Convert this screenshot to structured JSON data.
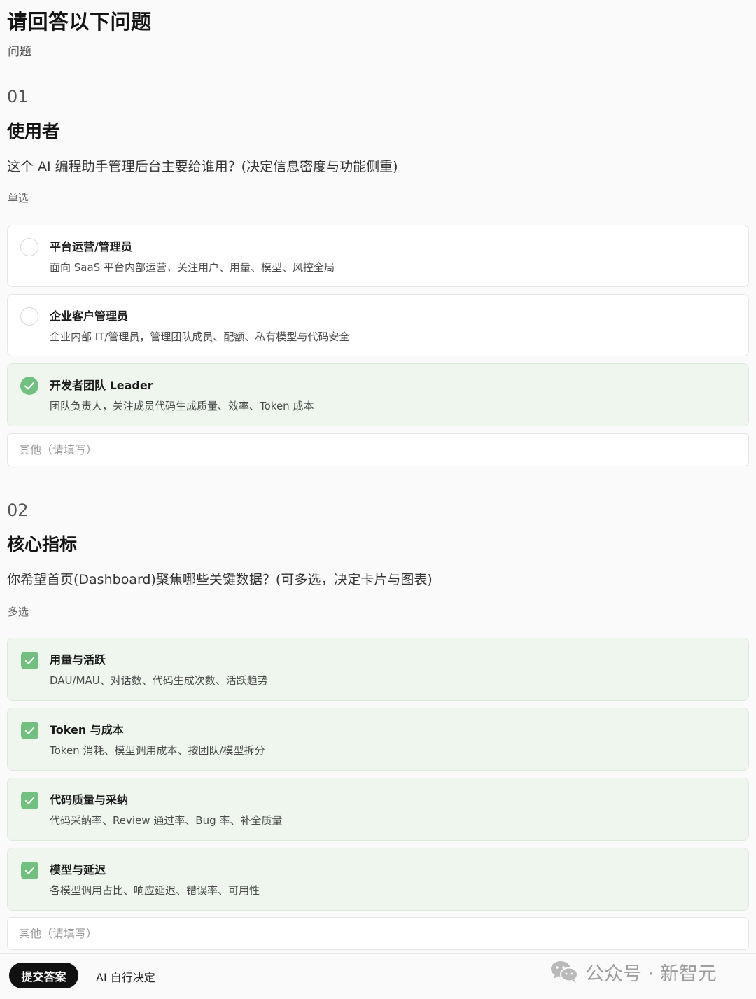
{
  "header": {
    "title": "请回答以下问题",
    "subtitle": "问题"
  },
  "questions": [
    {
      "number": "01",
      "title": "使用者",
      "description": "这个 AI 编程助手管理后台主要给谁用？(决定信息密度与功能侧重)",
      "type": "单选",
      "options": [
        {
          "label": "平台运营/管理员",
          "desc": "面向 SaaS 平台内部运营，关注用户、用量、模型、风控全局",
          "selected": false
        },
        {
          "label": "企业客户管理员",
          "desc": "企业内部 IT/管理员，管理团队成员、配额、私有模型与代码安全",
          "selected": false
        },
        {
          "label": "开发者团队 Leader",
          "desc": "团队负责人，关注成员代码生成质量、效率、Token 成本",
          "selected": true
        }
      ],
      "other_placeholder": "其他（请填写）"
    },
    {
      "number": "02",
      "title": "核心指标",
      "description": "你希望首页(Dashboard)聚焦哪些关键数据？(可多选，决定卡片与图表)",
      "type": "多选",
      "options": [
        {
          "label": "用量与活跃",
          "desc": "DAU/MAU、对话数、代码生成次数、活跃趋势",
          "selected": true
        },
        {
          "label": "Token 与成本",
          "desc": "Token 消耗、模型调用成本、按团队/模型拆分",
          "selected": true
        },
        {
          "label": "代码质量与采纳",
          "desc": "代码采纳率、Review 通过率、Bug 率、补全质量",
          "selected": true
        },
        {
          "label": "模型与延迟",
          "desc": "各模型调用占比、响应延迟、错误率、可用性",
          "selected": true
        }
      ],
      "other_placeholder": "其他（请填写）"
    }
  ],
  "footer": {
    "submit_label": "提交答案",
    "ai_decide_label": "AI 自行决定",
    "watermark_text": "公众号 · 新智元",
    "watermark_icon": "wechat-icon"
  },
  "colors": {
    "accent": "#72c07f",
    "selected_bg": "#eef6ee",
    "button_bg": "#111111"
  }
}
